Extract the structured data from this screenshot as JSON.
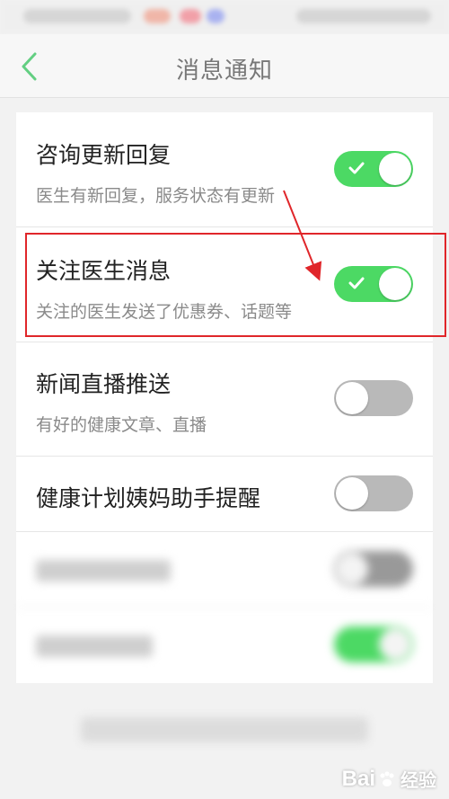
{
  "header": {
    "title": "消息通知",
    "back_icon": "chevron-left-icon",
    "back_color": "#63cf82"
  },
  "settings": [
    {
      "title": "咨询更新回复",
      "subtitle": "医生有新回复，服务状态有更新",
      "enabled": true
    },
    {
      "title": "关注医生消息",
      "subtitle": "关注的医生发送了优惠券、话题等",
      "enabled": true
    },
    {
      "title": "新闻直播推送",
      "subtitle": "有好的健康文章、直播",
      "enabled": false
    },
    {
      "title": "健康计划姨妈助手提醒",
      "subtitle": "",
      "enabled": false
    }
  ],
  "colors": {
    "toggle_on": "#4cd964",
    "toggle_off": "#b9b9b9",
    "annotation": "#e0262a"
  },
  "watermark": {
    "brand": "Bai",
    "word": "经验"
  }
}
